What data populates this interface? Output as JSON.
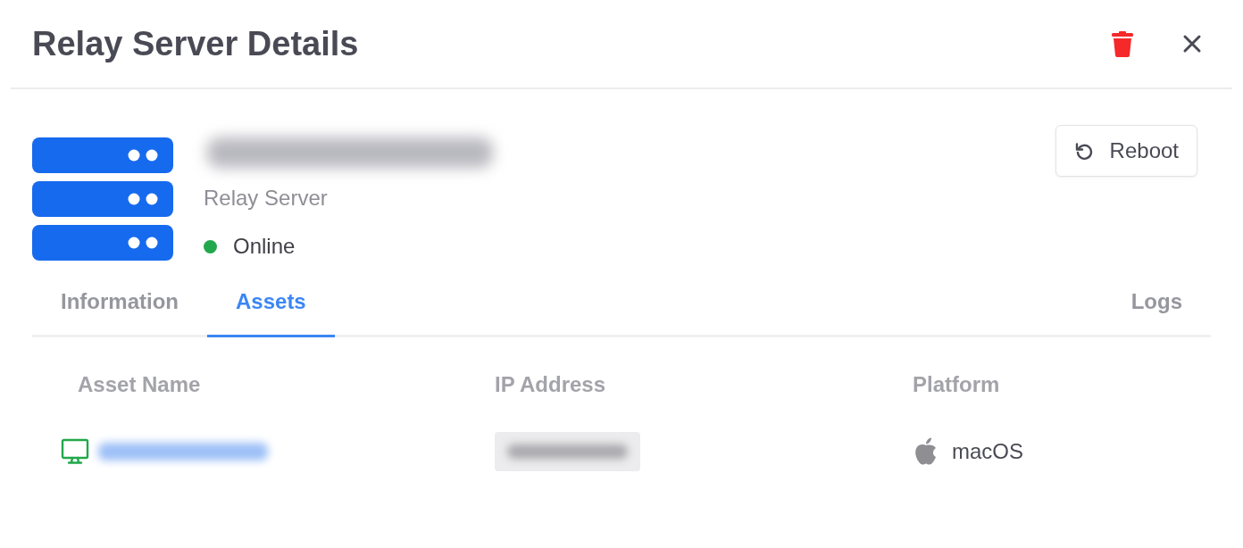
{
  "window": {
    "title": "Relay Server Details"
  },
  "server": {
    "type": "Relay Server",
    "status": {
      "label": "Online",
      "color": "#22a84c"
    }
  },
  "actions": [
    {
      "label": "Reboot"
    }
  ],
  "tabs": [
    {
      "label": "Information",
      "selected": false
    },
    {
      "label": "Assets",
      "selected": true
    },
    {
      "label": "Logs",
      "selected": false
    }
  ],
  "table": {
    "columns": [
      "Asset Name",
      "IP Address",
      "Platform"
    ],
    "rows": [
      {
        "platform": "macOS"
      }
    ]
  }
}
